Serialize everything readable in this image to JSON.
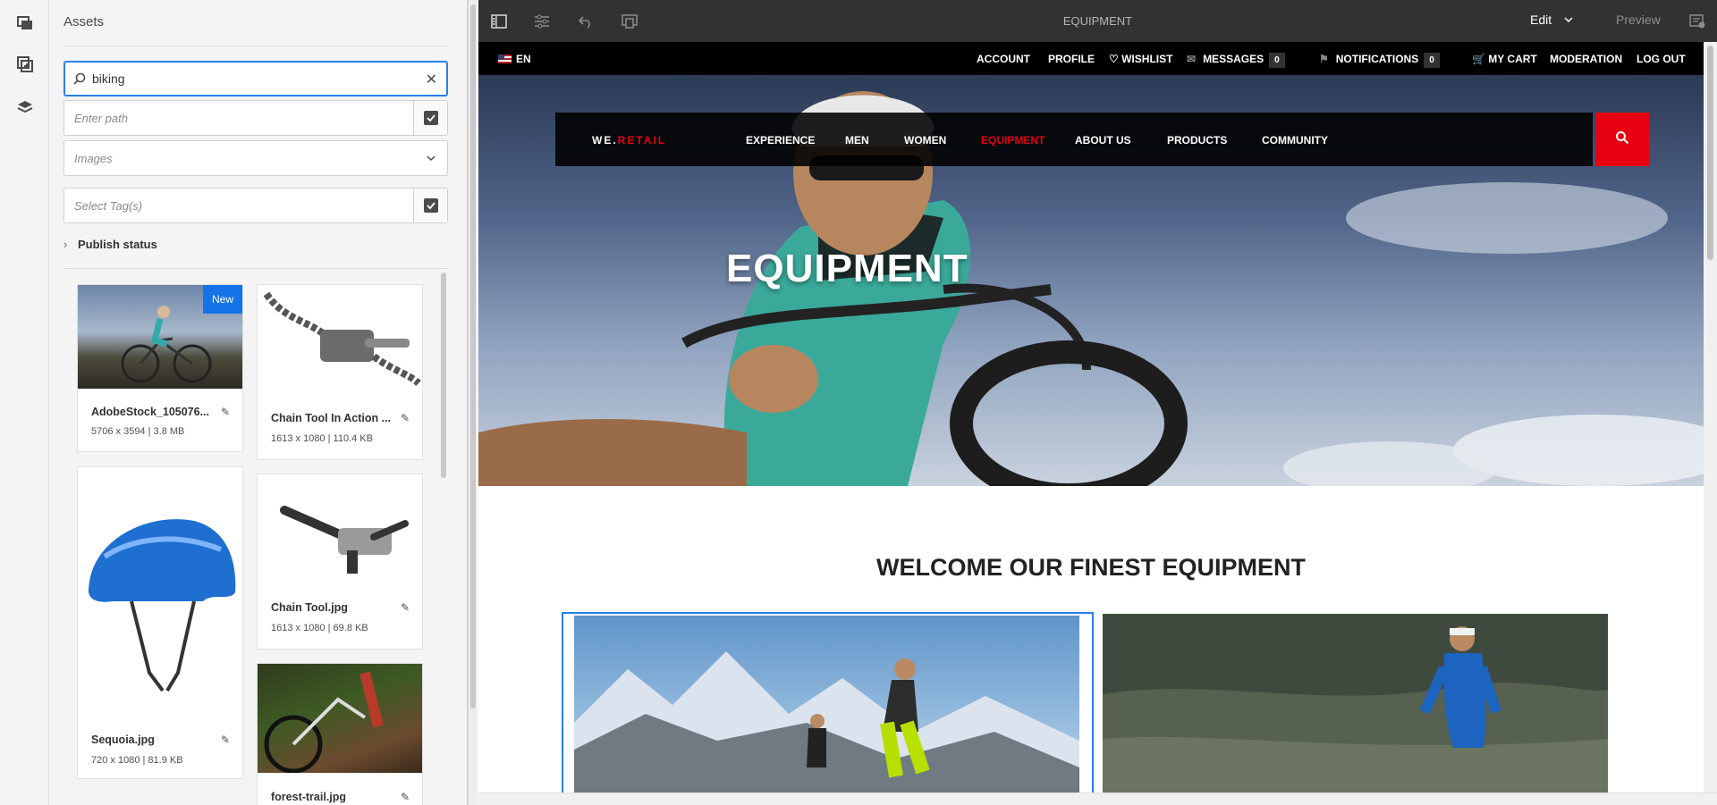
{
  "sidepanel": {
    "title": "Assets",
    "search_value": "biking",
    "path_placeholder": "Enter path",
    "type_placeholder": "Images",
    "tags_placeholder": "Select Tag(s)",
    "publish_status_label": "Publish status",
    "assets": [
      {
        "name": "AdobeStock_105076...",
        "meta": "5706 x 3594 | 3.8 MB",
        "badge": "New"
      },
      {
        "name": "Chain Tool In Action ...",
        "meta": "1613 x 1080 | 110.4 KB"
      },
      {
        "name": "Sequoia.jpg",
        "meta": "720 x 1080 | 81.9 KB"
      },
      {
        "name": "Chain Tool.jpg",
        "meta": "1613 x 1080 | 69.8 KB"
      },
      {
        "name": "forest-trail.jpg",
        "meta": ""
      }
    ]
  },
  "toolbar": {
    "page_title": "EQUIPMENT",
    "mode": "Edit",
    "preview": "Preview"
  },
  "site": {
    "language": "EN",
    "top_links": {
      "account": "ACCOUNT",
      "profile": "PROFILE",
      "wishlist": "WISHLIST",
      "messages": "MESSAGES",
      "messages_count": "0",
      "notifications": "NOTIFICATIONS",
      "notifications_count": "0",
      "cart": "MY CART",
      "moderation": "MODERATION",
      "logout": "LOG OUT"
    },
    "logo_prefix": "WE.",
    "logo_suffix": "RETAIL",
    "nav": [
      "EXPERIENCE",
      "MEN",
      "WOMEN",
      "EQUIPMENT",
      "ABOUT US",
      "PRODUCTS",
      "COMMUNITY"
    ],
    "hero_title": "EQUIPMENT",
    "welcome_heading": "WELCOME OUR FINEST EQUIPMENT"
  },
  "colors": {
    "accent_red": "#e60012",
    "selection_blue": "#2680eb",
    "badge_blue": "#1473e6"
  }
}
